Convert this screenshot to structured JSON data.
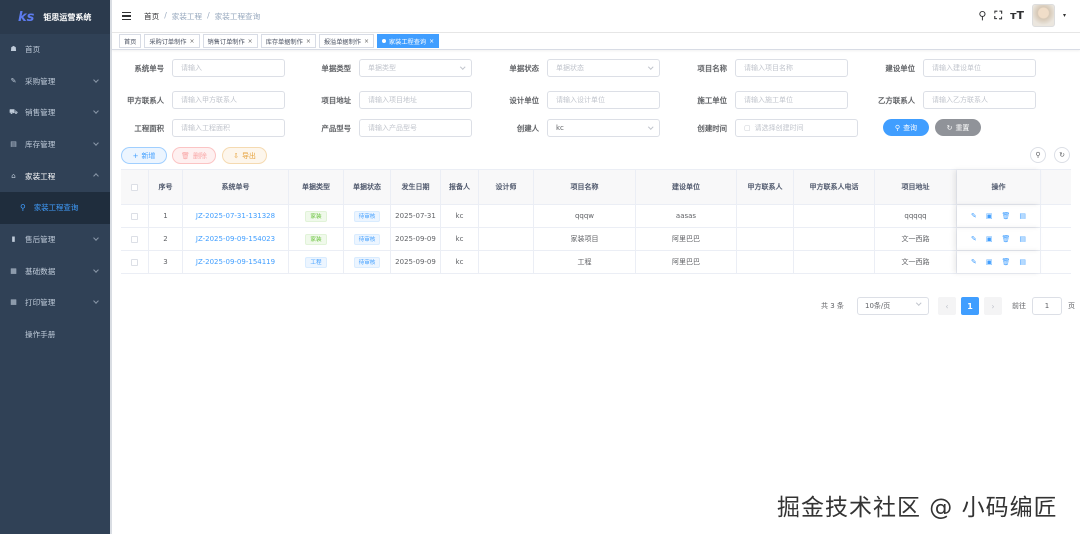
{
  "app": {
    "title": "钜思运营系统",
    "logo_glyph": "ks"
  },
  "sidebar": {
    "items": [
      {
        "label": "首页",
        "icon": "dashboard-icon",
        "glyph": "☗"
      },
      {
        "label": "采购管理",
        "icon": "edit-icon",
        "glyph": "✎"
      },
      {
        "label": "销售管理",
        "icon": "cart-icon",
        "glyph": "⛟"
      },
      {
        "label": "库存管理",
        "icon": "warehouse-icon",
        "glyph": "▤"
      },
      {
        "label": "家装工程",
        "icon": "home-icon",
        "glyph": "⌂"
      },
      {
        "label": "售后管理",
        "icon": "service-icon",
        "glyph": "▮"
      },
      {
        "label": "基础数据",
        "icon": "data-icon",
        "glyph": "▦"
      },
      {
        "label": "打印管理",
        "icon": "print-icon",
        "glyph": "▦"
      },
      {
        "label": "操作手册",
        "icon": "",
        "glyph": ""
      }
    ],
    "submenu": {
      "label": "家装工程查询",
      "icon": "search-icon",
      "glyph": "⚲"
    }
  },
  "breadcrumb": [
    "首页",
    "家装工程",
    "家装工程查询"
  ],
  "navbar_icons": {
    "search": "⚲",
    "fullscreen": "⛶",
    "font": "ᴛT",
    "avatar_arrow": "▾"
  },
  "tags": [
    {
      "label": "首页",
      "closable": false,
      "active": false
    },
    {
      "label": "采购订单制作",
      "closable": true,
      "active": false
    },
    {
      "label": "销售订单制作",
      "closable": true,
      "active": false
    },
    {
      "label": "库存单据制作",
      "closable": true,
      "active": false
    },
    {
      "label": "报溢单据制作",
      "closable": true,
      "active": false
    },
    {
      "label": "家装工程查询",
      "closable": true,
      "active": true
    }
  ],
  "form": {
    "row1": [
      {
        "label": "系统单号",
        "placeholder": "请输入",
        "value": "",
        "select": false
      },
      {
        "label": "单据类型",
        "placeholder": "单据类型",
        "value": "",
        "select": true
      },
      {
        "label": "单据状态",
        "placeholder": "单据状态",
        "value": "",
        "select": true
      },
      {
        "label": "项目名称",
        "placeholder": "请输入项目名称",
        "value": "",
        "select": false
      },
      {
        "label": "建设单位",
        "placeholder": "请输入建设单位",
        "value": "",
        "select": false
      }
    ],
    "row2": [
      {
        "label": "甲方联系人",
        "placeholder": "请输入甲方联系人",
        "value": "",
        "select": false
      },
      {
        "label": "项目地址",
        "placeholder": "请输入项目地址",
        "value": "",
        "select": false
      },
      {
        "label": "设计单位",
        "placeholder": "请输入设计单位",
        "value": "",
        "select": false
      },
      {
        "label": "施工单位",
        "placeholder": "请输入施工单位",
        "value": "",
        "select": false
      },
      {
        "label": "乙方联系人",
        "placeholder": "请输入乙方联系人",
        "value": "",
        "select": false
      }
    ],
    "row3": [
      {
        "label": "工程面积",
        "placeholder": "请输入工程面积",
        "value": "",
        "select": false
      },
      {
        "label": "产品型号",
        "placeholder": "请输入产品型号",
        "value": "",
        "select": false
      },
      {
        "label": "创建人",
        "placeholder": "",
        "value": "kc",
        "select": true
      },
      {
        "label": "创建时间",
        "placeholder": "请选择创建时间",
        "value": "",
        "select": false,
        "date": true
      }
    ],
    "search_label": "查询",
    "reset_label": "重置"
  },
  "toolbar": {
    "add": "新增",
    "delete": "删除",
    "export": "导出"
  },
  "table": {
    "columns": [
      "序号",
      "系统单号",
      "单据类型",
      "单据状态",
      "发生日期",
      "报备人",
      "设计师",
      "项目名称",
      "建设单位",
      "甲方联系人",
      "甲方联系人电话",
      "项目地址",
      "操作"
    ],
    "rows": [
      {
        "index": "1",
        "no": "JZ-2025-07-31-131328",
        "type": "家装",
        "type_color": "green",
        "status": "待审核",
        "date": "2025-07-31",
        "reporter": "kc",
        "designer": "",
        "project": "qqqw",
        "builder": "aasas",
        "contact": "",
        "phone": "",
        "address": "qqqqq"
      },
      {
        "index": "2",
        "no": "JZ-2025-09-09-154023",
        "type": "家装",
        "type_color": "green",
        "status": "待审核",
        "date": "2025-09-09",
        "reporter": "kc",
        "designer": "",
        "project": "家装项目",
        "builder": "阿里巴巴",
        "contact": "",
        "phone": "",
        "address": "文一西路"
      },
      {
        "index": "3",
        "no": "JZ-2025-09-09-154119",
        "type": "工程",
        "type_color": "blue",
        "status": "待审核",
        "date": "2025-09-09",
        "reporter": "kc",
        "designer": "",
        "project": "工程",
        "builder": "阿里巴巴",
        "contact": "",
        "phone": "",
        "address": "文一西路"
      }
    ]
  },
  "pagination": {
    "total": "共 3 条",
    "page_size": "10条/页",
    "current": "1",
    "goto_label": "前往",
    "goto_value": "1",
    "page_suffix": "页"
  },
  "watermark": "掘金技术社区 @ 小码编匠",
  "colors": {
    "primary": "#409eff",
    "sidebar": "#304156"
  }
}
